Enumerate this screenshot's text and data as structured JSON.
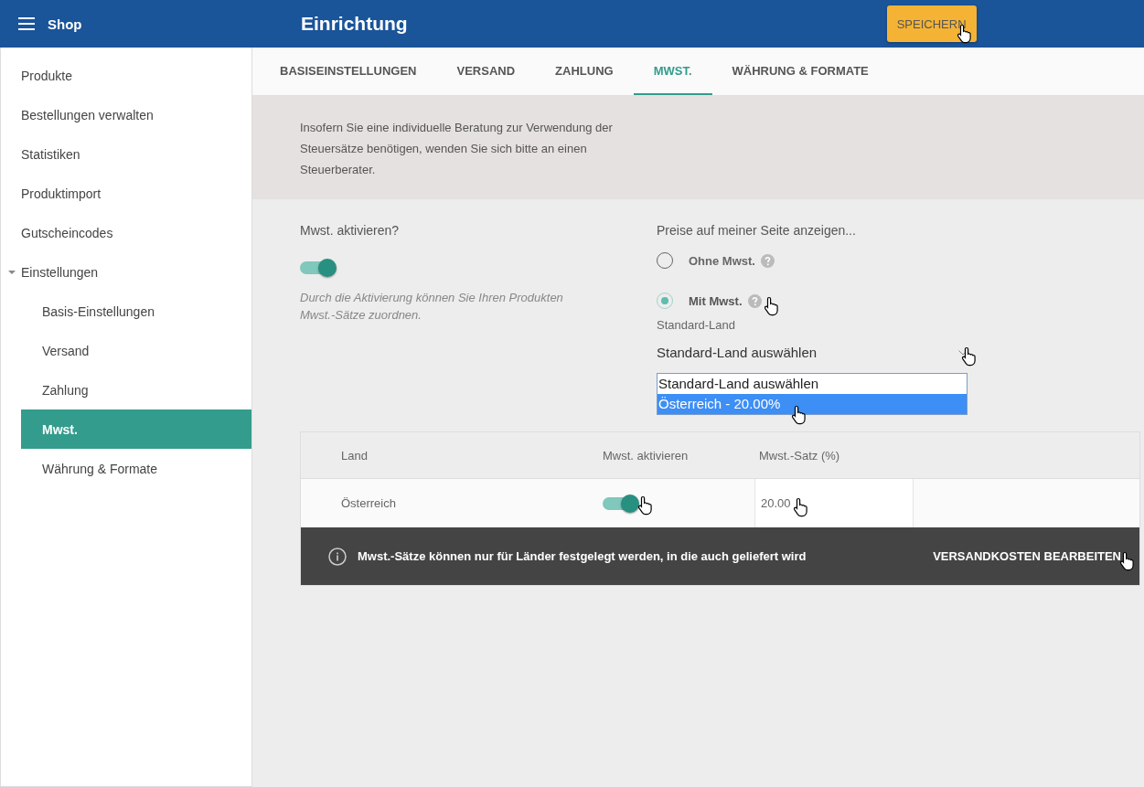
{
  "topbar": {
    "app_title": "Shop",
    "page_title": "Einrichtung",
    "save_button": "SPEICHERN"
  },
  "sidebar": {
    "items": [
      {
        "label": "Produkte",
        "selected": false
      },
      {
        "label": "Bestellungen verwalten",
        "selected": false
      },
      {
        "label": "Statistiken",
        "selected": false
      },
      {
        "label": "Produktimport",
        "selected": false
      },
      {
        "label": "Gutscheincodes",
        "selected": false
      },
      {
        "label": "Einstellungen",
        "selected": false,
        "expanded": true,
        "children": [
          {
            "label": "Basis-Einstellungen",
            "selected": false
          },
          {
            "label": "Versand",
            "selected": false
          },
          {
            "label": "Zahlung",
            "selected": false
          },
          {
            "label": "Mwst.",
            "selected": true
          },
          {
            "label": "Währung & Formate",
            "selected": false
          }
        ]
      }
    ]
  },
  "tabs": [
    {
      "label": "BASISEINSTELLUNGEN",
      "selected": false
    },
    {
      "label": "VERSAND",
      "selected": false
    },
    {
      "label": "ZAHLUNG",
      "selected": false
    },
    {
      "label": "MWST.",
      "selected": true
    },
    {
      "label": "WÄHRUNG & FORMATE",
      "selected": false
    }
  ],
  "notice": "Insofern Sie eine individuelle Beratung zur Verwendung der Steuersätze benötigen, wenden Sie sich bitte an einen Steuerberater.",
  "vat": {
    "label": "Mwst. aktivieren?",
    "on": true,
    "hint": "Durch die Aktivierung können Sie Ihren Produkten Mwst.-Sätze zuordnen."
  },
  "prices": {
    "label": "Preise auf meiner Seite anzeigen...",
    "options": [
      {
        "label": "Ohne Mwst.",
        "selected": false
      },
      {
        "label": "Mit Mwst.",
        "selected": true
      }
    ],
    "country_label": "Standard-Land",
    "country_value": "Standard-Land auswählen",
    "country_options": [
      {
        "label": "Standard-Land auswählen",
        "selected": false
      },
      {
        "label": "Österreich - 20.00%",
        "selected": true
      }
    ]
  },
  "table": {
    "columns": [
      "Land",
      "Mwst. aktivieren",
      "Mwst.-Satz (%)"
    ],
    "rows": [
      {
        "country": "Österreich",
        "vat_on": true,
        "rate": "20.00"
      }
    ]
  },
  "banner": {
    "text": "Mwst.-Sätze können nur für Länder festgelegt werden, in die auch geliefert wird",
    "action": "VERSANDKOSTEN BEARBEITEN"
  }
}
